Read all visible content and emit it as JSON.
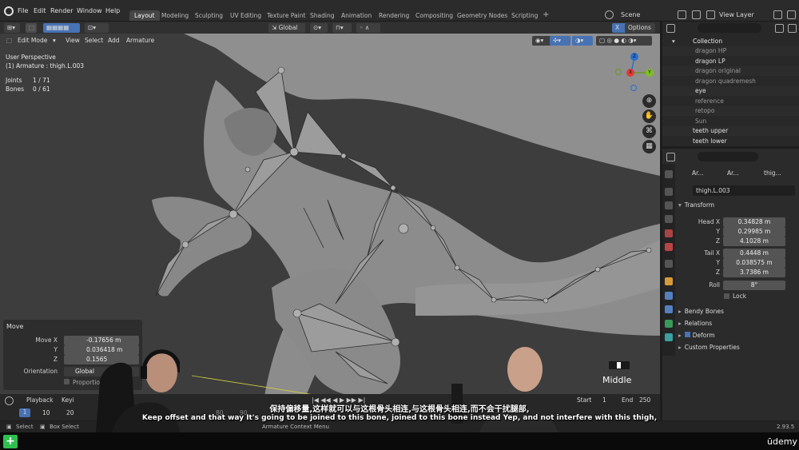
{
  "menu": [
    "File",
    "Edit",
    "Render",
    "Window",
    "Help"
  ],
  "workspaces": [
    "Layout",
    "Modeling",
    "Sculpting",
    "UV Editing",
    "Texture Paint",
    "Shading",
    "Animation",
    "Rendering",
    "Compositing",
    "Geometry Nodes",
    "Scripting"
  ],
  "active_workspace": "Layout",
  "scene": "Scene",
  "view_layer": "View Layer",
  "viewport": {
    "mode": "Edit Mode",
    "menus": [
      "View",
      "Select",
      "Add",
      "Armature"
    ],
    "orientation": "Global",
    "options": "Options",
    "perspective": "User Perspective",
    "object": "(1) Armature : thigh.L.003",
    "stats": {
      "joints_label": "Joints",
      "joints": "1 / 71",
      "bones_label": "Bones",
      "bones": "0 / 61"
    },
    "gizmo": {
      "x": "X",
      "y": "Y",
      "z": "Z"
    },
    "mouse_hint": "Middle"
  },
  "move_panel": {
    "title": "Move",
    "move_x_label": "Move X",
    "move_x": "-0.17656 m",
    "y_label": "Y",
    "y": "0.036418 m",
    "z_label": "Z",
    "z": "0.1565",
    "orientation_label": "Orientation",
    "orientation": "Global",
    "proportional": "Proportion"
  },
  "outliner": {
    "items": [
      {
        "name": "Collection"
      },
      {
        "name": "dragon HP"
      },
      {
        "name": "dragon LP"
      },
      {
        "name": "dragon original"
      },
      {
        "name": "dragon quadremesh"
      },
      {
        "name": "eye"
      },
      {
        "name": "reference"
      },
      {
        "name": "retopo"
      },
      {
        "name": "Sun"
      },
      {
        "name": "teeth upper"
      },
      {
        "name": "teeth lower"
      }
    ]
  },
  "properties": {
    "crumbs": [
      "Ar...",
      "Ar...",
      "thig..."
    ],
    "bone_name": "thigh.L.003",
    "transform": "Transform",
    "head_x_label": "Head X",
    "head_x": "0.34828 m",
    "head_y_label": "Y",
    "head_y": "0.29985 m",
    "head_z_label": "Z",
    "head_z": "4.1028 m",
    "tail_x_label": "Tail X",
    "tail_x": "0.4448 m",
    "tail_y_label": "Y",
    "tail_y": "0.038575 m",
    "tail_z_label": "Z",
    "tail_z": "3.7386 m",
    "roll_label": "Roll",
    "roll": "8°",
    "lock": "Lock",
    "sections": [
      "Bendy Bones",
      "Relations",
      "Deform",
      "Custom Properties"
    ]
  },
  "timeline": {
    "playback": "Playback",
    "keying": "Keyi",
    "frames": [
      "1",
      "10",
      "20",
      "80",
      "90"
    ],
    "current": "1",
    "start_label": "Start",
    "start": "1",
    "end_label": "End",
    "end": "250"
  },
  "status": {
    "select": "Select",
    "box_select": "Box Select",
    "context_menu": "Armature Context Menu",
    "version": "2.93.5"
  },
  "subtitles": {
    "zh": "保持偏移量,这样就可以与这根骨头相连,与这根骨头相连,而不会干扰腿部,",
    "en": "Keep offset and that way It's going to be joined to this bone, joined to this bone instead Yep, and not interfere with this thigh,"
  },
  "brand": "ūdemy",
  "colors": {
    "accent": "#4772b3",
    "bone": "#9a9a9a",
    "mesh": "#8c8c8c",
    "viewport_bg": "#3d3d3d"
  }
}
